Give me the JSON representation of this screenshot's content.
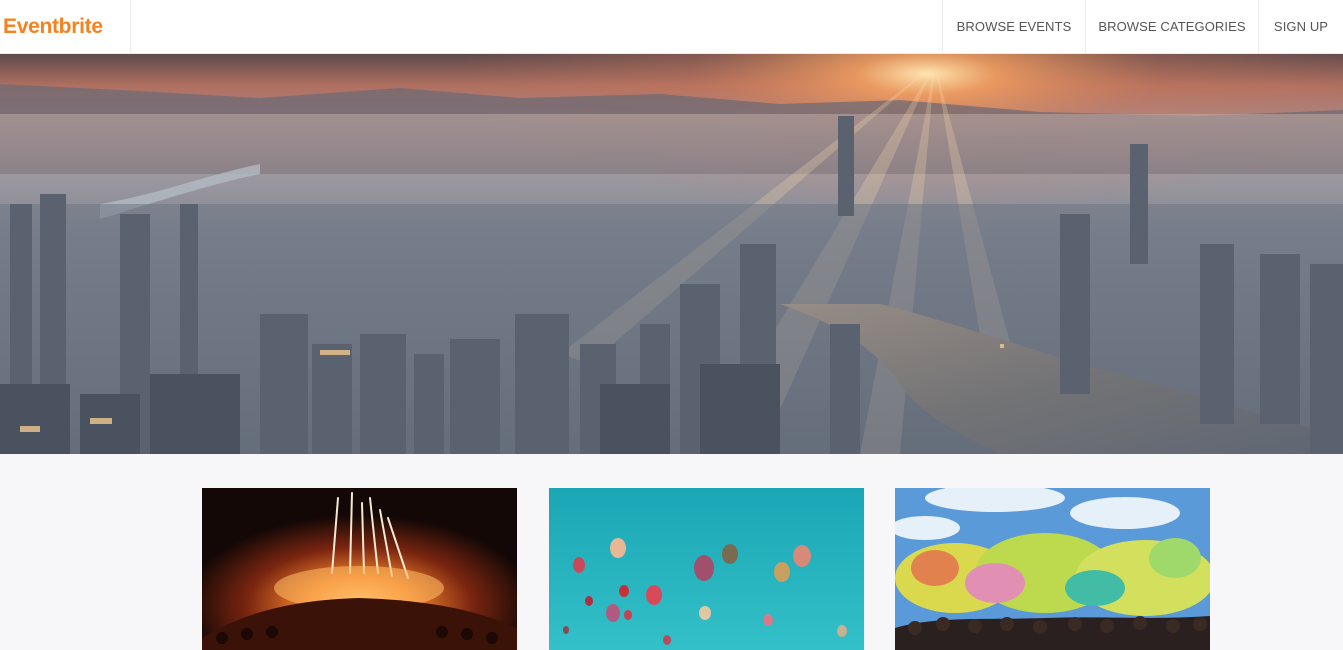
{
  "navbar": {
    "brand": "Eventbrite",
    "links": [
      {
        "label": "BROWSE EVENTS"
      },
      {
        "label": "BROWSE CATEGORIES"
      },
      {
        "label": "SIGN UP"
      }
    ]
  },
  "hero": {
    "image": "city-skyline-sunset-photo"
  },
  "cards": [
    {
      "image": "concert-fireworks-photo"
    },
    {
      "image": "hot-air-balloons-photo"
    },
    {
      "image": "color-festival-crowd-photo"
    }
  ],
  "colors": {
    "brand": "#f6821f",
    "nav_text": "#555555",
    "page_bg": "#f7f7f9"
  }
}
